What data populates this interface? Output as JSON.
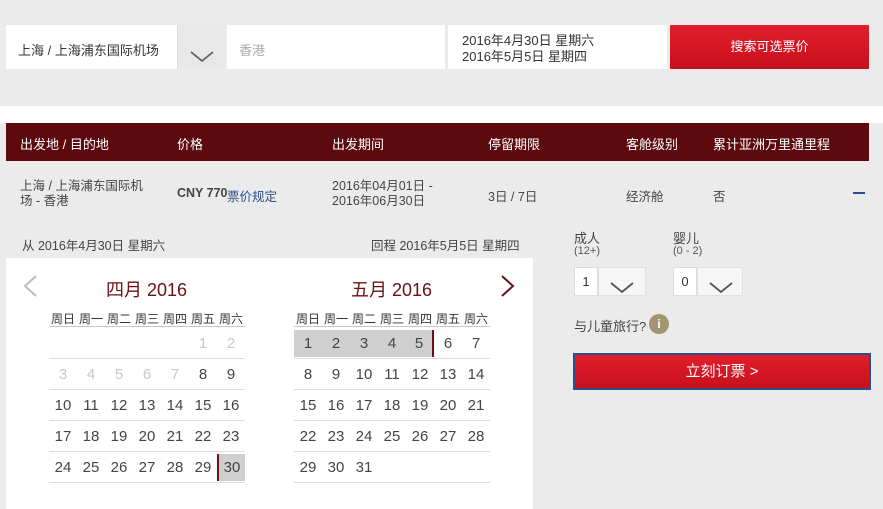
{
  "search": {
    "origin": "上海 / 上海浦东国际机场",
    "destination_placeholder": "香港",
    "depart_date": "2016年4月30日 星期六",
    "return_date": "2016年5月5日 星期四",
    "search_label": "搜索可选票价"
  },
  "results": {
    "headers": [
      "出发地 / 目的地",
      "价格",
      "出发期间",
      "停留期限",
      "客舱级别",
      "累计亚洲万里通里程"
    ],
    "row": {
      "route_line1": "上海 / 上海浦东国际机",
      "route_line2": "场 - 香港",
      "price": "CNY 770",
      "fare_rules": "票价规定",
      "period_line1": "2016年04月01日 -",
      "period_line2": "2016年06月30日",
      "stay": "3日 / 7日",
      "cabin": "经济舱",
      "miles": "否"
    }
  },
  "calendar": {
    "from_label": "从 2016年4月30日 星期六",
    "return_label": "回程 2016年5月5日 星期四",
    "weekdays": [
      "周日",
      "周一",
      "周二",
      "周三",
      "周四",
      "周五",
      "周六"
    ],
    "april": {
      "title": "四月 2016",
      "weeks": [
        [
          "",
          "",
          "",
          "",
          "",
          "1",
          "2"
        ],
        [
          "3",
          "4",
          "5",
          "6",
          "7",
          "8",
          "9"
        ],
        [
          "10",
          "11",
          "12",
          "13",
          "14",
          "15",
          "16"
        ],
        [
          "17",
          "18",
          "19",
          "20",
          "21",
          "22",
          "23"
        ],
        [
          "24",
          "25",
          "26",
          "27",
          "28",
          "29",
          "30"
        ]
      ]
    },
    "may": {
      "title": "五月 2016",
      "weeks": [
        [
          "1",
          "2",
          "3",
          "4",
          "5",
          "6",
          "7"
        ],
        [
          "8",
          "9",
          "10",
          "11",
          "12",
          "13",
          "14"
        ],
        [
          "15",
          "16",
          "17",
          "18",
          "19",
          "20",
          "21"
        ],
        [
          "22",
          "23",
          "24",
          "25",
          "26",
          "27",
          "28"
        ],
        [
          "29",
          "30",
          "31",
          "",
          "",
          "",
          ""
        ]
      ]
    }
  },
  "passengers": {
    "adult_label": "成人",
    "adult_range": "(12+)",
    "adult_value": "1",
    "infant_label": "婴儿",
    "infant_range": "(0 - 2)",
    "infant_value": "0",
    "child_question": "与儿童旅行?",
    "info_glyph": "i",
    "book_label": "立刻订票 >"
  },
  "colors": {
    "header_bg": "#5c0a0e",
    "button_red": "#d4141f",
    "link_blue": "#2b4f8a",
    "info_gold": "#a39572"
  }
}
